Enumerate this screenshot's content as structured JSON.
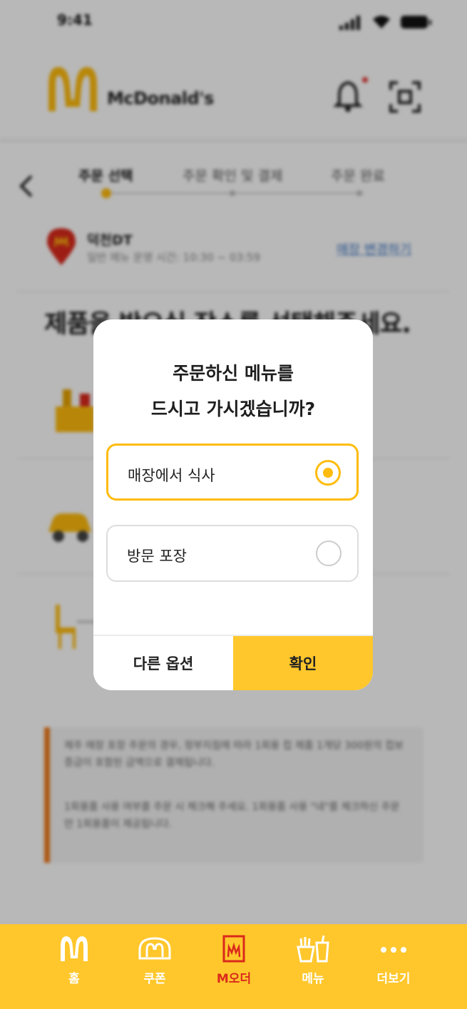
{
  "status_bar": {
    "time": "9:41"
  },
  "header": {
    "brand": "McDonald's"
  },
  "steps": [
    {
      "label": "주문 선택",
      "active": true
    },
    {
      "label": "주문 확인 및 결제",
      "active": false
    },
    {
      "label": "주문 완료",
      "active": false
    }
  ],
  "store": {
    "name": "덕천DT",
    "hours": "일반 메뉴 운영 시간: 10:30 ~ 03:59",
    "change_link": "매장 변경하기"
  },
  "page_title": "제품을 받으실 장소를 선택해주세요.",
  "notice": {
    "line1": "제주 매장 포장 주문의 경우, 정부지침에 따라 1회용 컵 제품 1개당 300원의 컵보증금이 포함된 금액으로 결제됩니다.",
    "line2": "1회용품 사용 여부를 주문 시 체크해 주세요. 1회용품 사용 \"네\"를 체크하신 주문만 1회용품이 제공됩니다."
  },
  "modal": {
    "title_line1": "주문하신 메뉴를",
    "title_line2": "드시고 가시겠습니까?",
    "options": [
      {
        "label": "매장에서 식사",
        "selected": true
      },
      {
        "label": "방문 포장",
        "selected": false
      }
    ],
    "secondary_button": "다른 옵션",
    "primary_button": "확인"
  },
  "tab_bar": {
    "tabs": [
      {
        "label": "홈",
        "icon": "mcdonalds-arches-icon",
        "active": false
      },
      {
        "label": "쿠폰",
        "icon": "coupon-icon",
        "active": false
      },
      {
        "label": "M오더",
        "icon": "m-order-bag-icon",
        "active": true
      },
      {
        "label": "메뉴",
        "icon": "menu-fries-drink-icon",
        "active": false
      },
      {
        "label": "더보기",
        "icon": "more-dots-icon",
        "active": false
      }
    ]
  },
  "colors": {
    "brand_yellow": "#FFC72C",
    "accent_yellow": "#FFBC0D",
    "brand_red": "#DA291C",
    "notice_orange": "#F07A1A"
  }
}
